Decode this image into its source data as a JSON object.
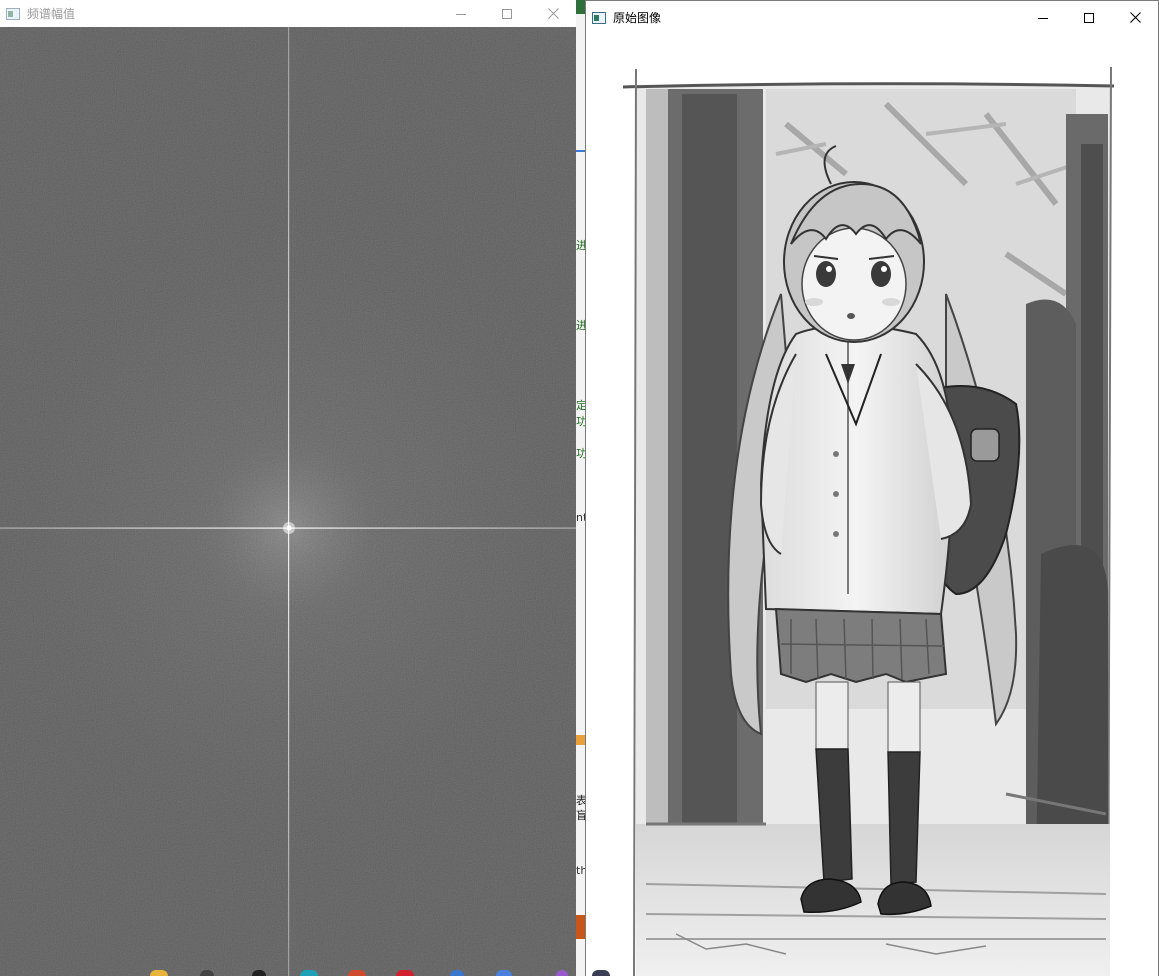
{
  "spectrum_window": {
    "title": "频谱幅值",
    "icon": "opencv-window-icon",
    "minimize_icon": "minimize-icon",
    "maximize_icon": "maximize-icon",
    "close_icon": "close-icon",
    "active": false
  },
  "original_window": {
    "title": "原始图像",
    "icon": "opencv-window-icon",
    "minimize_icon": "minimize-icon",
    "maximize_icon": "maximize-icon",
    "close_icon": "close-icon",
    "active": true
  },
  "background_strip": {
    "fragments": [
      "进",
      "进",
      "定",
      "功",
      "功",
      "nt",
      "表",
      "盲",
      "th"
    ]
  },
  "images": {
    "spectrum": "fft-magnitude-spectrum",
    "original": "grayscale-anime-schoolgirl-illustration"
  },
  "colors": {
    "spectrum_background": "#4a4a4a",
    "titlebar_inactive_text": "#9a9a9a",
    "strip_text": "#1f6e1f",
    "accent_orange": "#c8561a",
    "accent_blue": "#3b7bd4"
  }
}
